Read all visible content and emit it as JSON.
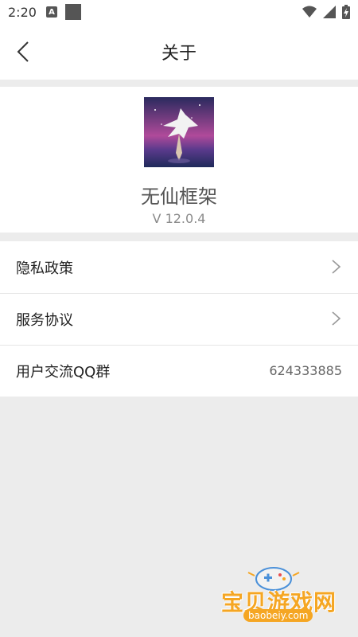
{
  "status_bar": {
    "time": "2:20",
    "a_badge": "A"
  },
  "header": {
    "title": "关于"
  },
  "app": {
    "name": "无仙框架",
    "version": "V 12.0.4"
  },
  "menu": {
    "items": [
      {
        "label": "隐私政策"
      },
      {
        "label": "服务协议"
      },
      {
        "label": "用户交流QQ群",
        "value": "624333885"
      }
    ]
  },
  "watermark": {
    "title": "宝贝游戏网",
    "url": "baobeiy.com"
  },
  "colors": {
    "background": "#ececec",
    "card": "#ffffff",
    "watermark": "#f5a623"
  }
}
